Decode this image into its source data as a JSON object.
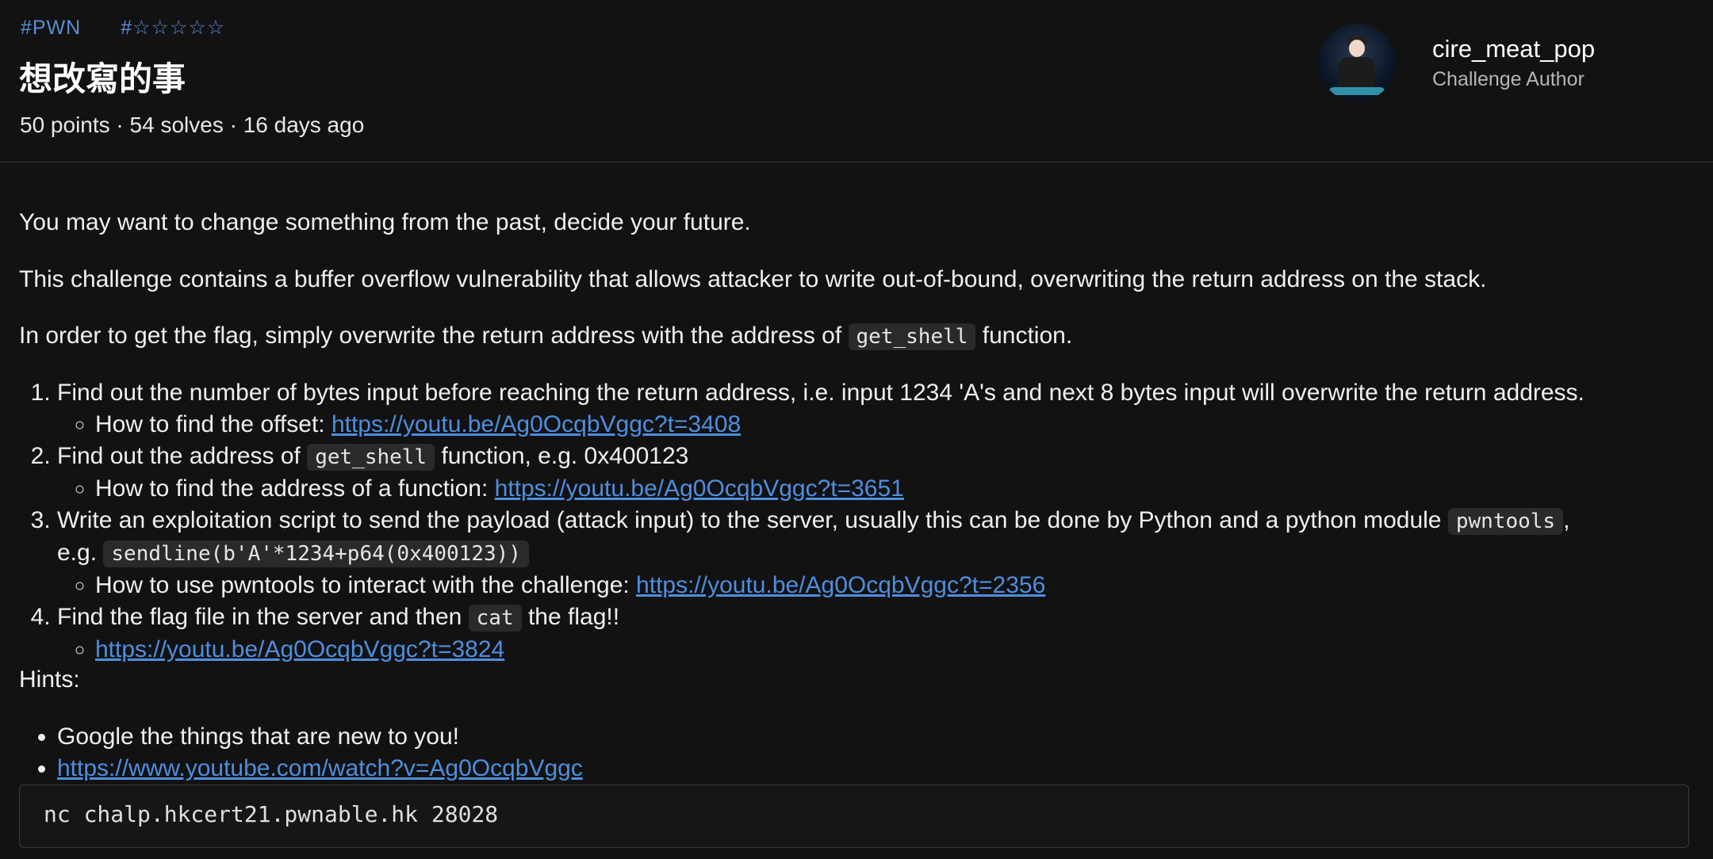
{
  "challenge": {
    "tags": [
      "#PWN",
      "#☆☆☆☆☆"
    ],
    "title": "想改寫的事",
    "meta": "50 points · 54 solves · 16 days ago"
  },
  "author": {
    "name": "cire_meat_pop",
    "role": "Challenge Author",
    "avatar_icon": "avatar-person-at-desk"
  },
  "description": {
    "intro": "You may want to change something from the past, decide your future.",
    "vuln": "This challenge contains a buffer overflow vulnerability that allows attacker to write out-of-bound, overwriting the return address on the stack.",
    "goal_before": "In order to get the flag, simply overwrite the return address with the address of",
    "goal_code": "get_shell",
    "goal_after": "function."
  },
  "steps": [
    {
      "text": "Find out the number of bytes input before reaching the return address, i.e. input 1234 'A's and next 8 bytes input will overwrite the return address.",
      "sub_label": "How to find the offset: ",
      "sub_link": "https://youtu.be/Ag0OcqbVggc?t=3408"
    },
    {
      "text_before": "Find out the address of",
      "code": "get_shell",
      "text_after": "function, e.g. 0x400123",
      "sub_label": "How to find the address of a function: ",
      "sub_link": "https://youtu.be/Ag0OcqbVggc?t=3651"
    },
    {
      "text_before": "Write an exploitation script to send the payload (attack input) to the server, usually this can be done by Python and a python module",
      "code": "pwntools",
      "text_mid": ",",
      "text_eg": "e.g.",
      "code2": "sendline(b'A'*1234+p64(0x400123))",
      "sub_label": "How to use pwntools to interact with the challenge: ",
      "sub_link": "https://youtu.be/Ag0OcqbVggc?t=2356"
    },
    {
      "text_before": "Find the flag file in the server and then",
      "code": "cat",
      "text_after": "the flag!!",
      "sub_link": "https://youtu.be/Ag0OcqbVggc?t=3824"
    }
  ],
  "hints": {
    "label": "Hints:",
    "items": [
      {
        "text": "Google the things that are new to you!"
      },
      {
        "link": "https://www.youtube.com/watch?v=Ag0OcqbVggc"
      }
    ]
  },
  "connection": "nc chalp.hkcert21.pwnable.hk 28028"
}
